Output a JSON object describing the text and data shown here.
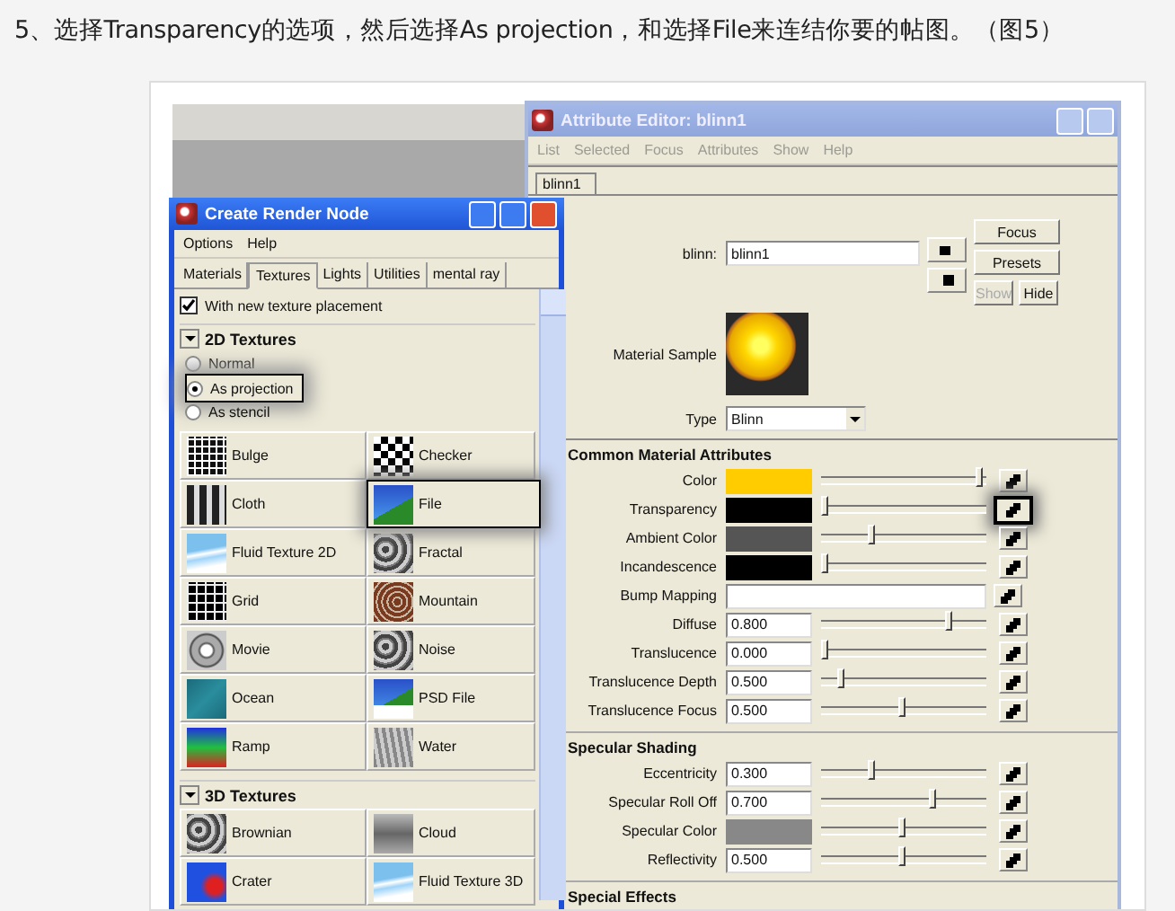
{
  "caption": "5、选择Transparency的选项，然后选择As projection，和选择File来连结你要的帖图。（图5）",
  "attribute_editor": {
    "title": "Attribute Editor: blinn1",
    "menu": [
      "List",
      "Selected",
      "Focus",
      "Attributes",
      "Show",
      "Help"
    ],
    "tab": "blinn1",
    "name_label": "blinn:",
    "name_value": "blinn1",
    "buttons": [
      {
        "label": "Focus",
        "disabled": false
      },
      {
        "label": "Presets",
        "disabled": false
      }
    ],
    "show_hide": [
      {
        "label": "Show",
        "disabled": true
      },
      {
        "label": "Hide",
        "disabled": false
      }
    ],
    "sample_label": "Material Sample",
    "type_label": "Type",
    "type_value": "Blinn",
    "sections": [
      {
        "title": "Common Material Attributes",
        "rows": [
          {
            "label": "Color",
            "kind": "color",
            "color": "#ffcc00",
            "level": 1,
            "highlighted": false
          },
          {
            "label": "Transparency",
            "kind": "color",
            "color": "#000000",
            "level": 0,
            "highlighted": true
          },
          {
            "label": "Ambient Color",
            "kind": "color",
            "color": "#555555",
            "level": 0.3,
            "highlighted": false
          },
          {
            "label": "Incandescence",
            "kind": "color",
            "color": "#000000",
            "level": 0,
            "highlighted": false
          },
          {
            "label": "Bump Mapping",
            "kind": "map",
            "highlighted": false
          },
          {
            "label": "Diffuse",
            "kind": "number",
            "value": "0.800",
            "level": 0.8,
            "highlighted": false
          },
          {
            "label": "Translucence",
            "kind": "number",
            "value": "0.000",
            "level": 0,
            "highlighted": false
          },
          {
            "label": "Translucence Depth",
            "kind": "number",
            "value": "0.500",
            "level": 0.1,
            "highlighted": false
          },
          {
            "label": "Translucence Focus",
            "kind": "number",
            "value": "0.500",
            "level": 0.5,
            "highlighted": false
          }
        ]
      },
      {
        "title": "Specular Shading",
        "rows": [
          {
            "label": "Eccentricity",
            "kind": "number",
            "value": "0.300",
            "level": 0.3,
            "highlighted": false
          },
          {
            "label": "Specular Roll Off",
            "kind": "number",
            "value": "0.700",
            "level": 0.7,
            "highlighted": false
          },
          {
            "label": "Specular Color",
            "kind": "color",
            "color": "#888888",
            "level": 0.5,
            "highlighted": false
          },
          {
            "label": "Reflectivity",
            "kind": "number",
            "value": "0.500",
            "level": 0.5,
            "highlighted": false
          }
        ]
      },
      {
        "title": "Special Effects"
      }
    ]
  },
  "render_node": {
    "title": "Create Render Node",
    "menu": [
      "Options",
      "Help"
    ],
    "tabs": [
      {
        "label": "Materials",
        "selected": false
      },
      {
        "label": "Textures",
        "selected": true
      },
      {
        "label": "Lights",
        "selected": false
      },
      {
        "label": "Utilities",
        "selected": false
      },
      {
        "label": "mental ray",
        "selected": false
      }
    ],
    "placement": {
      "label": "With new texture placement",
      "checked": true
    },
    "sections": [
      {
        "title": "2D Textures",
        "expanded": true,
        "options": [
          {
            "label": "Normal",
            "selected": false,
            "highlighted": false
          },
          {
            "label": "As projection",
            "selected": true,
            "highlighted": true
          },
          {
            "label": "As stencil",
            "selected": false,
            "highlighted": false
          }
        ],
        "items": [
          {
            "label": "Bulge",
            "kind": "bulge",
            "highlighted": false
          },
          {
            "label": "Checker",
            "kind": "checker",
            "highlighted": false
          },
          {
            "label": "Cloth",
            "kind": "cloth",
            "highlighted": false
          },
          {
            "label": "File",
            "kind": "file",
            "highlighted": true
          },
          {
            "label": "Fluid Texture 2D",
            "kind": "fluid",
            "highlighted": false
          },
          {
            "label": "Fractal",
            "kind": "fractal",
            "highlighted": false
          },
          {
            "label": "Grid",
            "kind": "grid",
            "highlighted": false
          },
          {
            "label": "Mountain",
            "kind": "mountain",
            "highlighted": false
          },
          {
            "label": "Movie",
            "kind": "movie",
            "highlighted": false
          },
          {
            "label": "Noise",
            "kind": "noise",
            "highlighted": false
          },
          {
            "label": "Ocean",
            "kind": "ocean",
            "highlighted": false
          },
          {
            "label": "PSD File",
            "kind": "psd",
            "highlighted": false
          },
          {
            "label": "Ramp",
            "kind": "ramp",
            "highlighted": false
          },
          {
            "label": "Water",
            "kind": "water",
            "highlighted": false
          }
        ]
      },
      {
        "title": "3D Textures",
        "expanded": true,
        "items": [
          {
            "label": "Brownian",
            "kind": "brownian",
            "highlighted": false
          },
          {
            "label": "Cloud",
            "kind": "cloud",
            "highlighted": false
          },
          {
            "label": "Crater",
            "kind": "crater",
            "highlighted": false
          },
          {
            "label": "Fluid Texture 3D",
            "kind": "fluid",
            "highlighted": false
          }
        ]
      }
    ]
  }
}
